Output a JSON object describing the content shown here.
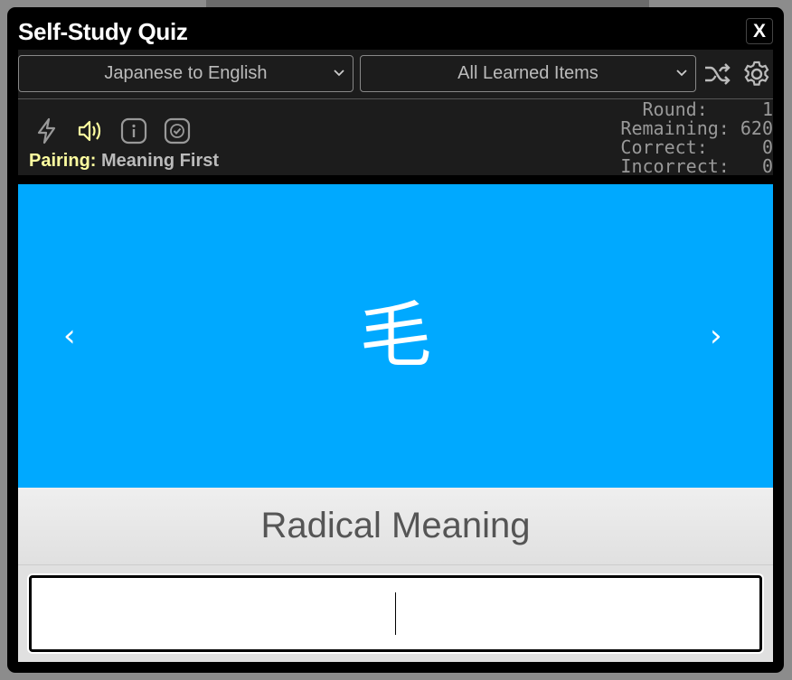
{
  "modal": {
    "title": "Self-Study Quiz",
    "close_label": "X"
  },
  "controls": {
    "direction": "Japanese to English",
    "item_set": "All Learned Items",
    "chevron": "⌄"
  },
  "toolbar": {
    "icons": [
      "lightning-icon",
      "speaker-icon",
      "info-icon",
      "check-icon",
      "shuffle-icon",
      "gear-icon"
    ],
    "speaker_active_color": "#ffffa0"
  },
  "pairing": {
    "label": "Pairing:",
    "value": "Meaning First"
  },
  "stats": {
    "round": "Round:     1",
    "remaining": "Remaining: 620",
    "correct": "Correct:     0",
    "incorrect": "Incorrect:   0"
  },
  "card": {
    "character": "毛",
    "prev": "‹",
    "next": "›",
    "color": "#00a9ff"
  },
  "prompt": {
    "label": "Radical Meaning"
  },
  "answer": {
    "value": ""
  }
}
